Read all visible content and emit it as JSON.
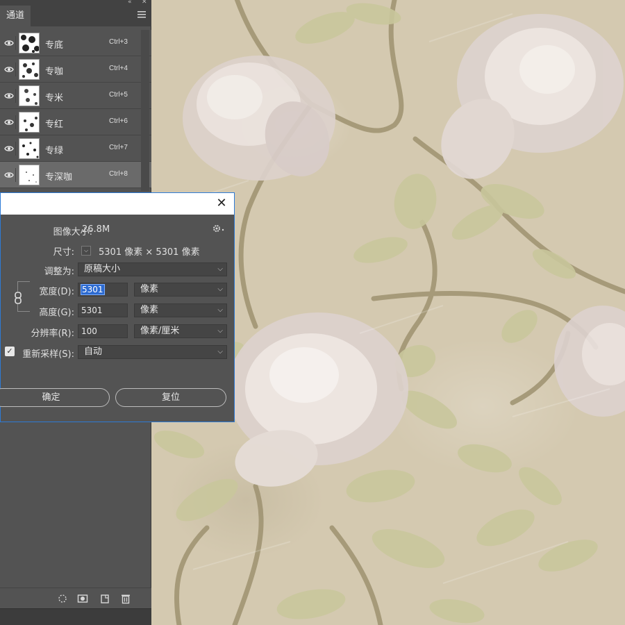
{
  "panel": {
    "tab_label": "通道",
    "collapse_glyph": "«",
    "close_glyph": "✕",
    "menu_icon": "menu-icon",
    "channels": [
      {
        "name": "专底",
        "shortcut": "Ctrl+3",
        "visible": true,
        "selected": false
      },
      {
        "name": "专咖",
        "shortcut": "Ctrl+4",
        "visible": true,
        "selected": false
      },
      {
        "name": "专米",
        "shortcut": "Ctrl+5",
        "visible": true,
        "selected": false
      },
      {
        "name": "专红",
        "shortcut": "Ctrl+6",
        "visible": true,
        "selected": false
      },
      {
        "name": "专绿",
        "shortcut": "Ctrl+7",
        "visible": true,
        "selected": false
      },
      {
        "name": "专深咖",
        "shortcut": "Ctrl+8",
        "visible": true,
        "selected": true
      }
    ],
    "footer_icons": [
      "dotted-circle-selection-icon",
      "save-selection-channel-icon",
      "new-channel-icon",
      "trash-icon"
    ]
  },
  "dialog": {
    "close_glyph": "✕",
    "image_size_label": "图像大小:",
    "image_size_value": "26.8M",
    "gear_glyph": "✱",
    "dimensions_label": "尺寸:",
    "dimensions_toggle": "⌵",
    "dimensions_value": "5301 像素 × 5301 像素",
    "fit_to_label": "调整为:",
    "fit_to_value": "原稿大小",
    "width_label": "宽度(D):",
    "width_value": "5301",
    "width_unit": "像素",
    "height_label": "高度(G):",
    "height_value": "5301",
    "height_unit": "像素",
    "resolution_label": "分辨率(R):",
    "resolution_value": "100",
    "resolution_unit": "像素/厘米",
    "resample_label": "重新采样(S):",
    "resample_checked": true,
    "resample_value": "自动",
    "ok_label": "确定",
    "reset_label": "复位",
    "dropdown_arrow": "⌵",
    "accent_color": "#2d6bd1"
  },
  "canvas": {
    "background_color": "#d4c9b0",
    "flower_color": "#e9dfdc",
    "leaf_color": "#c9c79c",
    "stem_color": "#9e9270"
  }
}
